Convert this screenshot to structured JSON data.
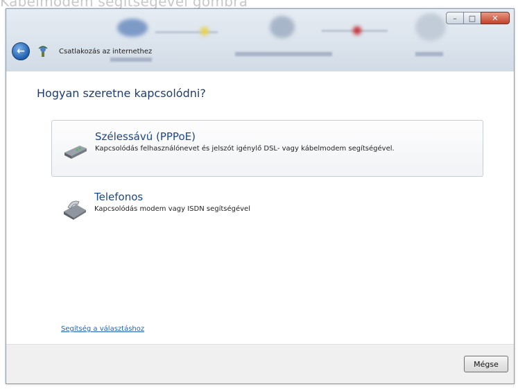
{
  "caption": "Kábelmodem segítségével gombra",
  "window": {
    "title": "Csatlakozás az internethez",
    "controls": {
      "minimize": "–",
      "maximize": "□",
      "close": "✕"
    }
  },
  "heading": "Hogyan szeretne kapcsolódni?",
  "options": [
    {
      "title": "Szélessávú (PPPoE)",
      "description": "Kapcsolódás felhasználónevet és jelszót igénylő DSL- vagy kábelmodem segítségével.",
      "icon": "broadband-modem-icon",
      "selected": true
    },
    {
      "title": "Telefonos",
      "description": "Kapcsolódás modem vagy ISDN segítségével",
      "icon": "dialup-modem-icon",
      "selected": false
    }
  ],
  "help_link": "Segítség a választáshoz",
  "footer": {
    "cancel_label": "Mégse"
  },
  "colors": {
    "heading": "#1e3c73",
    "link": "#1f63b5",
    "footer_bg": "#f0f0f0"
  }
}
